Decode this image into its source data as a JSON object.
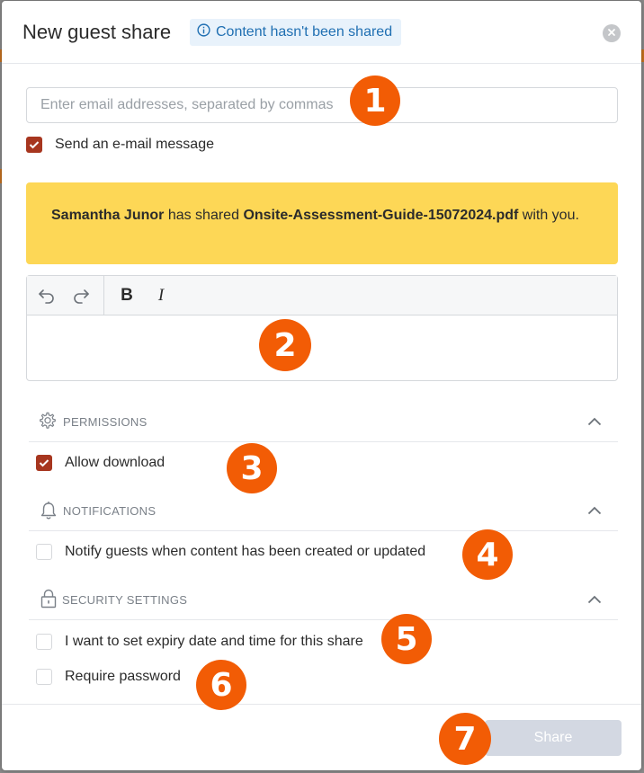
{
  "dialog": {
    "title": "New guest share",
    "status_text": "Content hasn't been shared"
  },
  "email": {
    "placeholder": "Enter email addresses, separated by commas",
    "value": ""
  },
  "send_email": {
    "label": "Send an e-mail message",
    "checked": true
  },
  "message_banner": {
    "sender": "Samantha Junor",
    "verb": "has shared",
    "file": "Onsite-Assessment-Guide-15072024.pdf",
    "suffix": "with you."
  },
  "editor": {
    "tools": [
      "undo-icon",
      "redo-icon",
      "bold-icon",
      "italic-icon"
    ],
    "bold_glyph": "B",
    "italic_glyph": "I"
  },
  "permissions": {
    "title": "PERMISSIONS",
    "allow_download": {
      "label": "Allow download",
      "checked": true
    }
  },
  "notifications": {
    "title": "NOTIFICATIONS",
    "notify_guests": {
      "label": "Notify guests when content has been created or updated",
      "checked": false
    }
  },
  "security": {
    "title": "SECURITY SETTINGS",
    "expiry": {
      "label": "I want to set expiry date and time for this share",
      "checked": false
    },
    "password": {
      "label": "Require password",
      "checked": false
    }
  },
  "footer": {
    "share_label": "Share"
  },
  "markers": [
    "1",
    "2",
    "3",
    "4",
    "5",
    "6",
    "7"
  ],
  "colors": {
    "accent": "#a7361f",
    "banner": "#fdd756",
    "marker": "#f25c05",
    "info": "#1f6fb2",
    "share_disabled": "#d3d8e2"
  }
}
